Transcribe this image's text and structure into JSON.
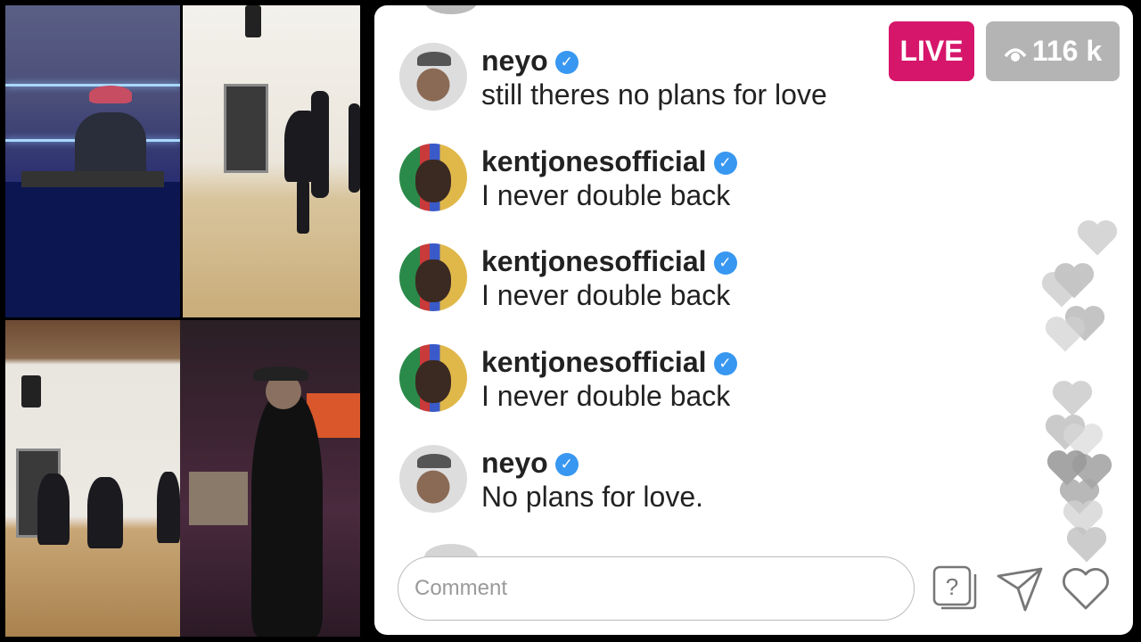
{
  "video": {
    "tiles": [
      "dj-tile",
      "dance-tile-1",
      "dance-tile-2",
      "studio-tile"
    ]
  },
  "status": {
    "live_label": "LIVE",
    "viewers": "116 k",
    "live_color": "#d6166b",
    "viewers_color": "#b4b4b4"
  },
  "messages": [
    {
      "user": "neyo",
      "text": "still theres no plans for love",
      "avatar": "neyo"
    },
    {
      "user": "kentjonesofficial",
      "text": "I never double back",
      "avatar": "kent"
    },
    {
      "user": "kentjonesofficial",
      "text": "I never double back",
      "avatar": "kent"
    },
    {
      "user": "kentjonesofficial",
      "text": "I never double back",
      "avatar": "kent"
    },
    {
      "user": "neyo",
      "text": "No plans for love.",
      "avatar": "neyo"
    }
  ],
  "composer": {
    "placeholder": "Comment",
    "icons": [
      "question-icon",
      "send-icon",
      "heart-icon"
    ]
  },
  "verified_color": "#3897f0"
}
